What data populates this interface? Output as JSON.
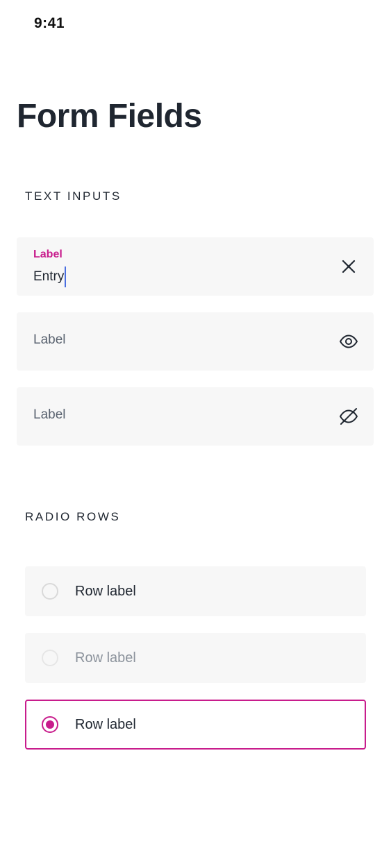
{
  "status_bar": {
    "time": "9:41"
  },
  "page": {
    "title": "Form Fields"
  },
  "sections": {
    "text_inputs": {
      "heading": "TEXT INPUTS",
      "fields": [
        {
          "label": "Label",
          "value": "Entry",
          "state": "focused",
          "trailing_icon": "clear-icon"
        },
        {
          "placeholder": "Label",
          "state": "empty",
          "trailing_icon": "eye-icon"
        },
        {
          "placeholder": "Label",
          "state": "empty",
          "trailing_icon": "eye-off-icon"
        }
      ]
    },
    "radio_rows": {
      "heading": "RADIO ROWS",
      "rows": [
        {
          "label": "Row label",
          "state": "default",
          "selected": false
        },
        {
          "label": "Row label",
          "state": "disabled",
          "selected": false
        },
        {
          "label": "Row label",
          "state": "selected",
          "selected": true
        }
      ]
    }
  },
  "colors": {
    "accent": "#c81c8c",
    "caret": "#4a6ee0",
    "field_background": "#f7f7f7",
    "text_primary": "#1f2630",
    "text_placeholder": "#5a6370",
    "text_disabled": "#8c939c"
  }
}
